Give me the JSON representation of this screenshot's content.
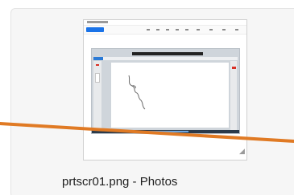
{
  "file_card": {
    "caption": "prtscr01.png - Photos",
    "thumbnail_icon": "image-preview",
    "grip_icon": "resize-grip-icon"
  },
  "colors": {
    "annotation_line": "#e07a24",
    "card_background": "#f6f6f6",
    "accent_blue": "#1a73e8"
  }
}
